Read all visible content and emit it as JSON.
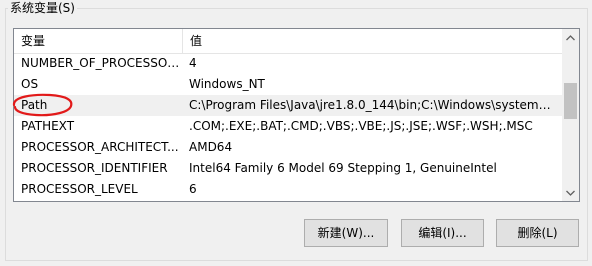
{
  "group_title": "系统变量(S)",
  "columns": {
    "name": "变量",
    "value": "值"
  },
  "rows": [
    {
      "name": "NUMBER_OF_PROCESSORS",
      "value": "4"
    },
    {
      "name": "OS",
      "value": "Windows_NT"
    },
    {
      "name": "Path",
      "value": "C:\\Program Files\\Java\\jre1.8.0_144\\bin;C:\\Windows\\system32;..."
    },
    {
      "name": "PATHEXT",
      "value": ".COM;.EXE;.BAT;.CMD;.VBS;.VBE;.JS;.JSE;.WSF;.WSH;.MSC"
    },
    {
      "name": "PROCESSOR_ARCHITECT...",
      "value": "AMD64"
    },
    {
      "name": "PROCESSOR_IDENTIFIER",
      "value": "Intel64 Family 6 Model 69 Stepping 1, GenuineIntel"
    },
    {
      "name": "PROCESSOR_LEVEL",
      "value": "6"
    }
  ],
  "selected_row": 2,
  "buttons": {
    "new": "新建(W)...",
    "edit": "编辑(I)...",
    "delete": "删除(L)"
  },
  "colors": {
    "annotation": "#e21a1a",
    "selected_row": "#f0f0f0"
  },
  "icons": {
    "scroll_up": "chevron-up-icon",
    "scroll_down": "chevron-down-icon",
    "annotation": "red-circle-annotation"
  }
}
